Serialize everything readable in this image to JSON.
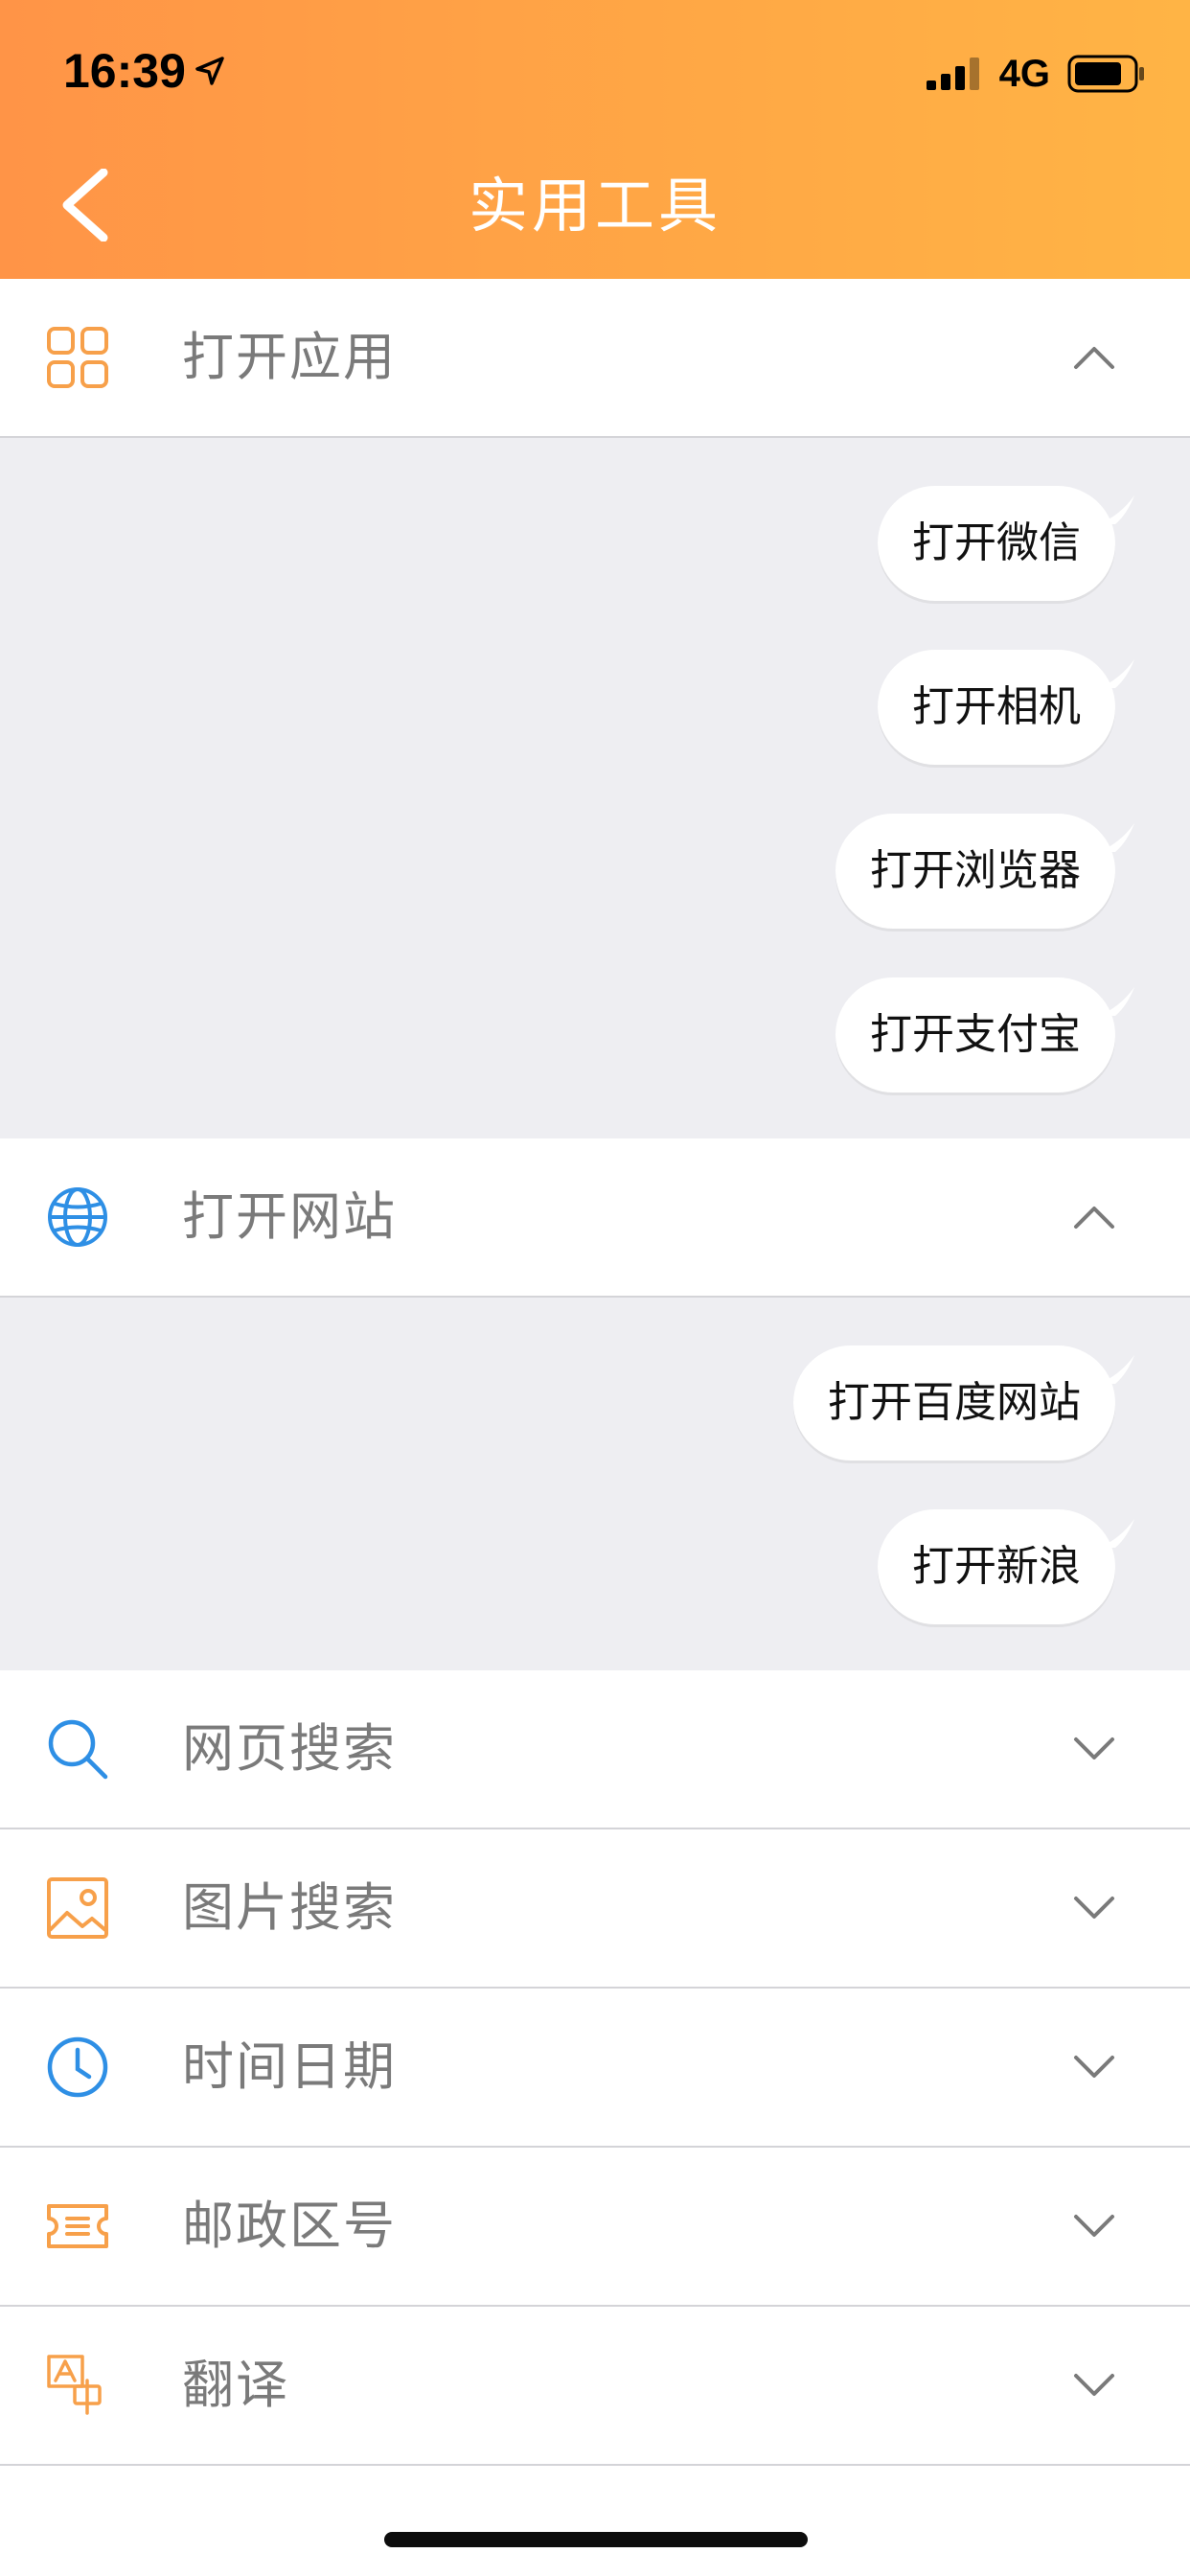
{
  "status_bar": {
    "time": "16:39",
    "network": "4G"
  },
  "header": {
    "title": "实用工具"
  },
  "sections": [
    {
      "label": "打开应用",
      "icon": "grid-apps-icon",
      "expanded": true,
      "items": [
        "打开微信",
        "打开相机",
        "打开浏览器",
        "打开支付宝"
      ]
    },
    {
      "label": "打开网站",
      "icon": "globe-icon",
      "expanded": true,
      "items": [
        "打开百度网站",
        "打开新浪"
      ]
    },
    {
      "label": "网页搜索",
      "icon": "search-icon",
      "expanded": false,
      "items": []
    },
    {
      "label": "图片搜索",
      "icon": "image-icon",
      "expanded": false,
      "items": []
    },
    {
      "label": "时间日期",
      "icon": "clock-icon",
      "expanded": false,
      "items": []
    },
    {
      "label": "邮政区号",
      "icon": "ticket-icon",
      "expanded": false,
      "items": []
    },
    {
      "label": "翻译",
      "icon": "translate-icon",
      "expanded": false,
      "items": []
    }
  ],
  "colors": {
    "accent_orange": "#F7A04A",
    "accent_blue": "#2E8FE5",
    "header_gradient_start": "#FF9447",
    "header_gradient_end": "#FFB445",
    "panel_background": "#EEEEF2"
  }
}
